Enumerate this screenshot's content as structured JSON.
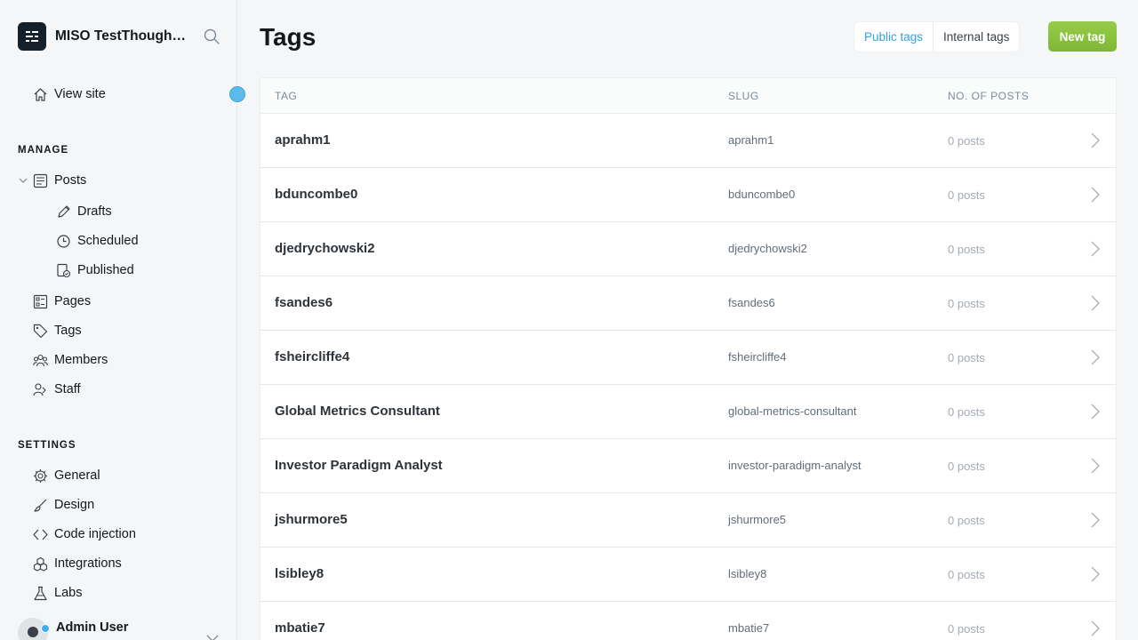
{
  "sidebar": {
    "brand": "MISO TestThoughtful",
    "view_site": "View site",
    "manage_label": "MANAGE",
    "posts": "Posts",
    "drafts": "Drafts",
    "scheduled": "Scheduled",
    "published": "Published",
    "pages": "Pages",
    "tags": "Tags",
    "members": "Members",
    "staff": "Staff",
    "settings_label": "SETTINGS",
    "general": "General",
    "design": "Design",
    "code_injection": "Code injection",
    "integrations": "Integrations",
    "labs": "Labs",
    "user_name": "Admin User"
  },
  "header": {
    "title": "Tags",
    "public_tags": "Public tags",
    "internal_tags": "Internal tags",
    "new_tag": "New tag"
  },
  "table": {
    "columns": {
      "tag": "TAG",
      "slug": "SLUG",
      "posts": "NO. OF POSTS"
    },
    "rows": [
      {
        "name": "aprahm1",
        "slug": "aprahm1",
        "count": "0 posts"
      },
      {
        "name": "bduncombe0",
        "slug": "bduncombe0",
        "count": "0 posts"
      },
      {
        "name": "djedrychowski2",
        "slug": "djedrychowski2",
        "count": "0 posts"
      },
      {
        "name": "fsandes6",
        "slug": "fsandes6",
        "count": "0 posts"
      },
      {
        "name": "fsheircliffe4",
        "slug": "fsheircliffe4",
        "count": "0 posts"
      },
      {
        "name": "Global Metrics Consultant",
        "slug": "global-metrics-consultant",
        "count": "0 posts"
      },
      {
        "name": "Investor Paradigm Analyst",
        "slug": "investor-paradigm-analyst",
        "count": "0 posts"
      },
      {
        "name": "jshurmore5",
        "slug": "jshurmore5",
        "count": "0 posts"
      },
      {
        "name": "lsibley8",
        "slug": "lsibley8",
        "count": "0 posts"
      },
      {
        "name": "mbatie7",
        "slug": "mbatie7",
        "count": "0 posts"
      }
    ]
  },
  "colors": {
    "accent": "#30a4e0",
    "primary_button": "#8ac43f",
    "brand_logo": "#15212a"
  }
}
